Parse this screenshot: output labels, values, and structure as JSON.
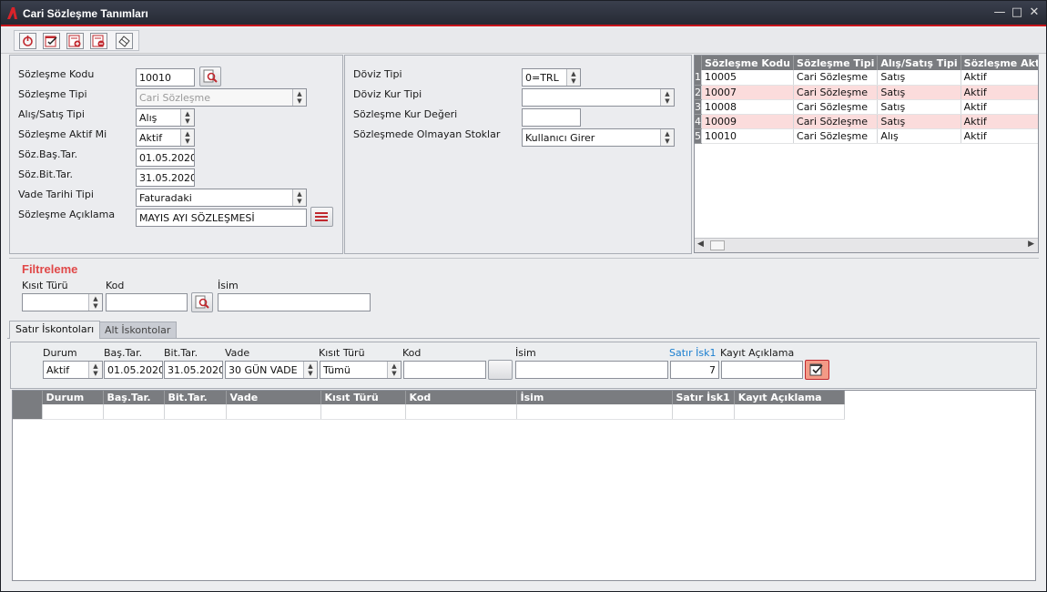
{
  "window": {
    "title": "Cari Sözleşme Tanımları"
  },
  "form": {
    "sozlesme_kodu": {
      "label": "Sözleşme Kodu",
      "value": "10010"
    },
    "sozlesme_tipi": {
      "label": "Sözleşme Tipi",
      "value": "Cari Sözleşme"
    },
    "alis_satis_tipi": {
      "label": "Alış/Satış Tipi",
      "value": "Alış"
    },
    "aktif_mi": {
      "label": "Sözleşme Aktif Mi",
      "value": "Aktif"
    },
    "bas_tar": {
      "label": "Söz.Baş.Tar.",
      "value": "01.05.2020"
    },
    "bit_tar": {
      "label": "Söz.Bit.Tar.",
      "value": "31.05.2020"
    },
    "vade_tarihi_tipi": {
      "label": "Vade Tarihi Tipi",
      "value": "Faturadaki"
    },
    "aciklama": {
      "label": "Sözleşme Açıklama",
      "value": "MAYIS AYI SÖZLEŞMESİ"
    }
  },
  "currency": {
    "doviz_tipi": {
      "label": "Döviz Tipi",
      "value": "0=TRL"
    },
    "doviz_kur_tipi": {
      "label": "Döviz Kur Tipi",
      "value": ""
    },
    "kur_degeri": {
      "label": "Sözleşme Kur Değeri",
      "value": ""
    },
    "olmayan_stoklar": {
      "label": "Sözleşmede Olmayan Stoklar",
      "value": "Kullanıcı Girer"
    }
  },
  "list_grid": {
    "columns": [
      "Sözleşme Kodu",
      "Sözleşme Tipi",
      "Alış/Satış Tipi",
      "Sözleşme Aktif M"
    ],
    "rows": [
      {
        "n": "1",
        "kod": "10005",
        "tip": "Cari Sözleşme",
        "as": "Satış",
        "aktif": "Aktif"
      },
      {
        "n": "2",
        "kod": "10007",
        "tip": "Cari Sözleşme",
        "as": "Satış",
        "aktif": "Aktif"
      },
      {
        "n": "3",
        "kod": "10008",
        "tip": "Cari Sözleşme",
        "as": "Satış",
        "aktif": "Aktif"
      },
      {
        "n": "4",
        "kod": "10009",
        "tip": "Cari Sözleşme",
        "as": "Satış",
        "aktif": "Aktif"
      },
      {
        "n": "5",
        "kod": "10010",
        "tip": "Cari Sözleşme",
        "as": "Alış",
        "aktif": "Aktif"
      }
    ]
  },
  "filter": {
    "title": "Filtreleme",
    "kisit_turu_label": "Kısıt Türü",
    "kod_label": "Kod",
    "isim_label": "İsim",
    "kisit_turu_value": "",
    "kod_value": "",
    "isim_value": ""
  },
  "tabs": [
    "Satır İskontoları",
    "Alt İskontolar"
  ],
  "entry": {
    "labels": {
      "durum": "Durum",
      "bas": "Baş.Tar.",
      "bit": "Bit.Tar.",
      "vade": "Vade",
      "kisit": "Kısıt Türü",
      "kod": "Kod",
      "isim": "İsim",
      "isk1": "Satır İsk1",
      "kayit": "Kayıt Açıklama"
    },
    "values": {
      "durum": "Aktif",
      "bas": "01.05.2020",
      "bit": "31.05.2020",
      "vade": "30 GÜN VADE",
      "kisit": "Tümü",
      "kod": "",
      "isim": "",
      "isk1": "7",
      "kayit": ""
    }
  },
  "detail_grid": {
    "columns": [
      "Durum",
      "Baş.Tar.",
      "Bit.Tar.",
      "Vade",
      "Kısıt Türü",
      "Kod",
      "İsim",
      "Satır İsk1",
      "Kayıt Açıklama"
    ]
  },
  "colors": {
    "accent": "#c8141a",
    "highlight_row": "#fbdcdc",
    "filter_title": "#e04848",
    "link_label": "#1a7fd0"
  }
}
